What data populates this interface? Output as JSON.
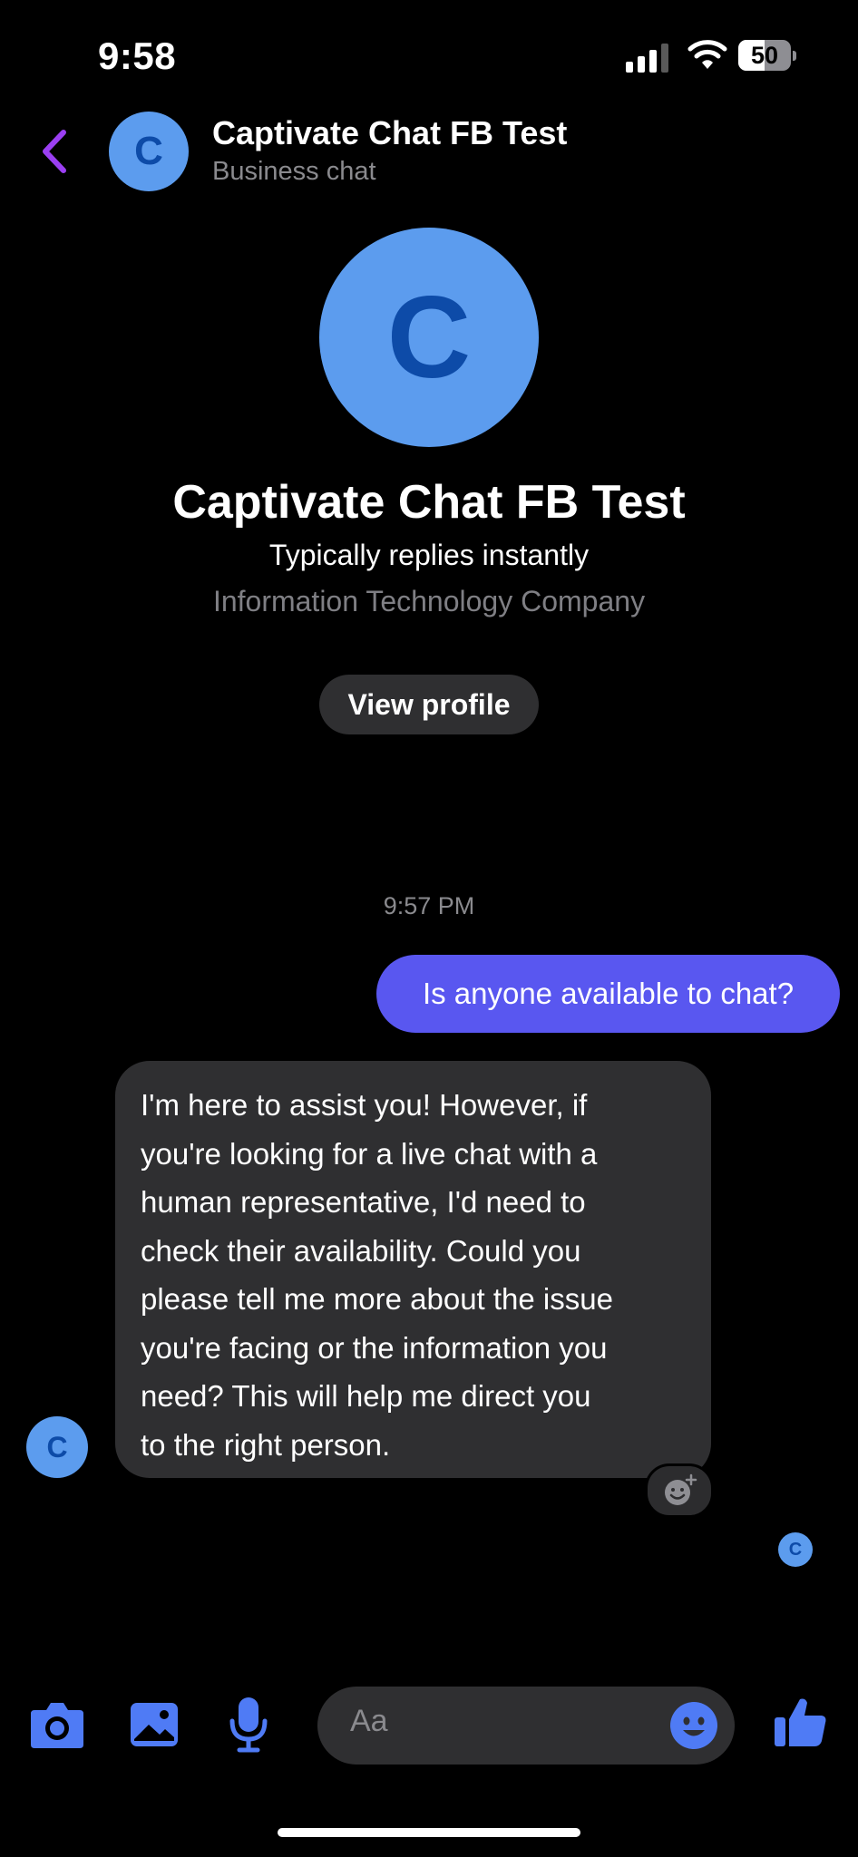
{
  "status_bar": {
    "time": "9:58",
    "battery": "50",
    "battery_level": 0.5
  },
  "header": {
    "avatar_letter": "C",
    "name": "Captivate Chat FB Test",
    "subtitle": "Business chat"
  },
  "profile": {
    "avatar_letter": "C",
    "name": "Captivate Chat FB Test",
    "reply_time": "Typically replies instantly",
    "category": "Information Technology Company",
    "view_button": "View profile"
  },
  "conversation": {
    "timestamp": "9:57 PM",
    "messages": [
      {
        "direction": "outgoing",
        "text": "Is anyone available to chat?"
      },
      {
        "direction": "incoming",
        "avatar_letter": "C",
        "lines": [
          "I'm here to assist you! However, if",
          "you're looking for a live chat with a",
          "human representative, I'd need to",
          "check their availability. Could you",
          "please tell me more about the issue",
          "you're facing or the information you",
          "need? This will help me direct you",
          "to the right person."
        ]
      }
    ],
    "seen_avatar_letter": "C"
  },
  "composer": {
    "placeholder": "Aa"
  },
  "icons": {
    "back": "chevron-left-icon",
    "camera": "camera-icon",
    "gallery": "image-icon",
    "mic": "microphone-icon",
    "emoji": "smiley-icon",
    "like": "thumbs-up-icon",
    "react": "add-reaction-icon"
  },
  "colors": {
    "background": "#000000",
    "accent": "#4f7bf5",
    "back_chevron": "#9b3ff2",
    "outgoing_bubble": "#5957f0",
    "incoming_bubble": "#2f2f31",
    "avatar_bg": "#5c9cee",
    "avatar_letter": "#0d4ba8"
  }
}
